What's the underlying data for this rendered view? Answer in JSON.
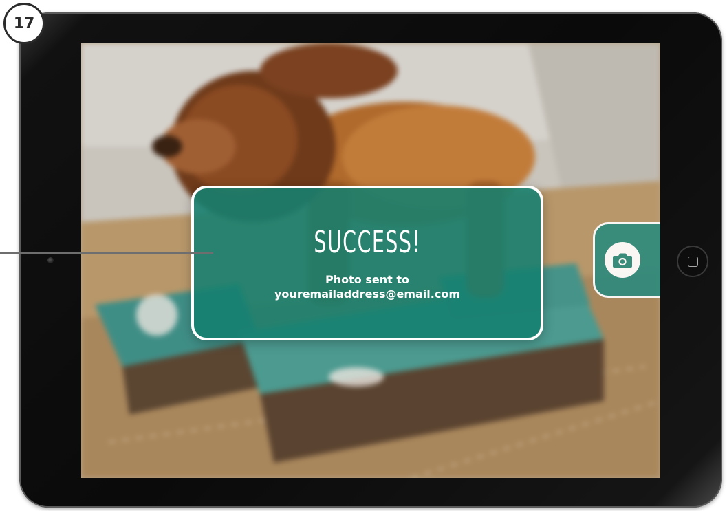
{
  "step_badge": "17",
  "dialog": {
    "title": "SUCCESS!",
    "message_line1": "Photo sent to",
    "message_line2": "youremailaddress@email.com"
  },
  "camera_button": {
    "icon": "camera-icon"
  },
  "colors": {
    "dialog_bg": "#148070",
    "accent_teal": "#2f8a7c",
    "border_white": "#ffffff"
  }
}
